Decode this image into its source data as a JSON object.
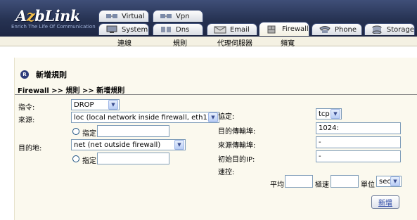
{
  "brand": {
    "logo_text_a": "A",
    "logo_text_z": "z",
    "logo_text_rest": "bLink",
    "slogan": "Enrich The Life Of Communication"
  },
  "tabs_top": [
    {
      "label": "Virtual",
      "icon": "network-icon"
    },
    {
      "label": "Vpn",
      "icon": "vpn-icon"
    }
  ],
  "tabs_bottom": [
    {
      "label": "System",
      "icon": "system-icon"
    },
    {
      "label": "Dns",
      "icon": "dns-icon"
    },
    {
      "label": "Email",
      "icon": "email-icon"
    },
    {
      "label": "Firewall",
      "icon": "firewall-icon",
      "active": true
    },
    {
      "label": "Phone",
      "icon": "phone-icon"
    },
    {
      "label": "Storage",
      "icon": "storage-icon"
    }
  ],
  "subnav": [
    "連線",
    "規則",
    "代理伺服器",
    "頻寬"
  ],
  "page": {
    "title": "新增規則",
    "breadcrumb": "Firewall >> 規則 >> 新增規則"
  },
  "form": {
    "command_label": "指令:",
    "command_value": "DROP",
    "source_label": "來源:",
    "source_value": "loc (local network inside firewall, eth1)",
    "specify_label": "指定",
    "dest_label": "目的地:",
    "dest_value": "net (net outside firewall)",
    "protocol_label": "協定:",
    "protocol_value": "tcp",
    "dest_port_label": "目的傳輸埠:",
    "dest_port_value": "1024:",
    "src_port_label": "來源傳輸埠:",
    "src_port_value": "-",
    "orig_dest_ip_label": "初始目的IP:",
    "orig_dest_ip_value": "-",
    "rate_label": "速控:",
    "avg_label": "平均",
    "burst_label": "極速",
    "unit_label": "單位",
    "unit_value": "sec",
    "add_button": "新增"
  },
  "colors": {
    "header": "#263252",
    "subnav": "#f4f1e3",
    "content": "#fbf9ee",
    "accent": "#2d3c7a"
  }
}
